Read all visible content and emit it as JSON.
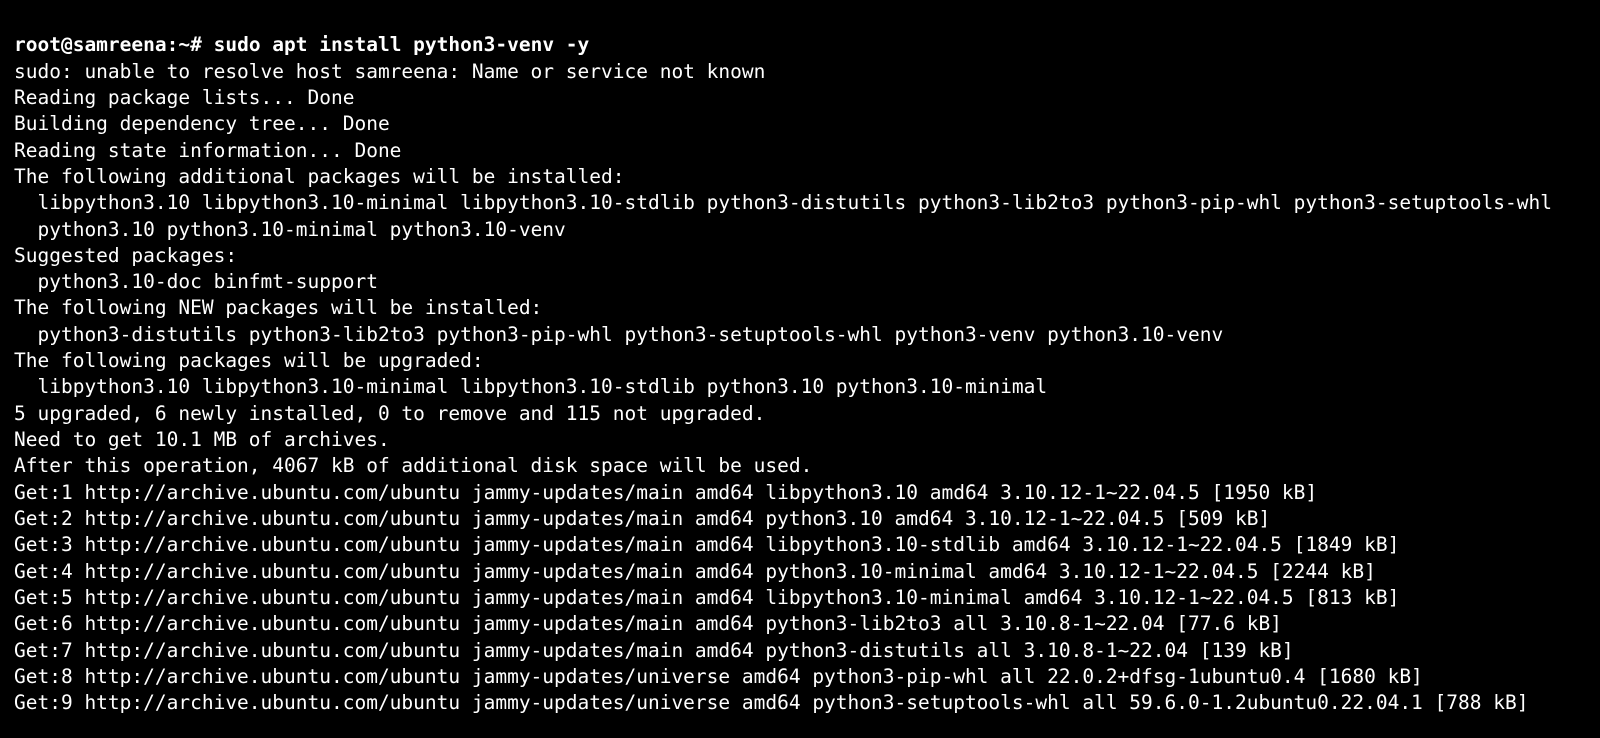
{
  "prompt": "root@samreena:~# ",
  "command": "sudo apt install python3-venv -y",
  "lines": [
    "sudo: unable to resolve host samreena: Name or service not known",
    "Reading package lists... Done",
    "Building dependency tree... Done",
    "Reading state information... Done",
    "The following additional packages will be installed:",
    "  libpython3.10 libpython3.10-minimal libpython3.10-stdlib python3-distutils python3-lib2to3 python3-pip-whl python3-setuptools-whl",
    "  python3.10 python3.10-minimal python3.10-venv",
    "Suggested packages:",
    "  python3.10-doc binfmt-support",
    "The following NEW packages will be installed:",
    "  python3-distutils python3-lib2to3 python3-pip-whl python3-setuptools-whl python3-venv python3.10-venv",
    "The following packages will be upgraded:",
    "  libpython3.10 libpython3.10-minimal libpython3.10-stdlib python3.10 python3.10-minimal",
    "5 upgraded, 6 newly installed, 0 to remove and 115 not upgraded.",
    "Need to get 10.1 MB of archives.",
    "After this operation, 4067 kB of additional disk space will be used.",
    "Get:1 http://archive.ubuntu.com/ubuntu jammy-updates/main amd64 libpython3.10 amd64 3.10.12-1~22.04.5 [1950 kB]",
    "Get:2 http://archive.ubuntu.com/ubuntu jammy-updates/main amd64 python3.10 amd64 3.10.12-1~22.04.5 [509 kB]",
    "Get:3 http://archive.ubuntu.com/ubuntu jammy-updates/main amd64 libpython3.10-stdlib amd64 3.10.12-1~22.04.5 [1849 kB]",
    "Get:4 http://archive.ubuntu.com/ubuntu jammy-updates/main amd64 python3.10-minimal amd64 3.10.12-1~22.04.5 [2244 kB]",
    "Get:5 http://archive.ubuntu.com/ubuntu jammy-updates/main amd64 libpython3.10-minimal amd64 3.10.12-1~22.04.5 [813 kB]",
    "Get:6 http://archive.ubuntu.com/ubuntu jammy-updates/main amd64 python3-lib2to3 all 3.10.8-1~22.04 [77.6 kB]",
    "Get:7 http://archive.ubuntu.com/ubuntu jammy-updates/main amd64 python3-distutils all 3.10.8-1~22.04 [139 kB]",
    "Get:8 http://archive.ubuntu.com/ubuntu jammy-updates/universe amd64 python3-pip-whl all 22.0.2+dfsg-1ubuntu0.4 [1680 kB]",
    "Get:9 http://archive.ubuntu.com/ubuntu jammy-updates/universe amd64 python3-setuptools-whl all 59.6.0-1.2ubuntu0.22.04.1 [788 kB]"
  ]
}
